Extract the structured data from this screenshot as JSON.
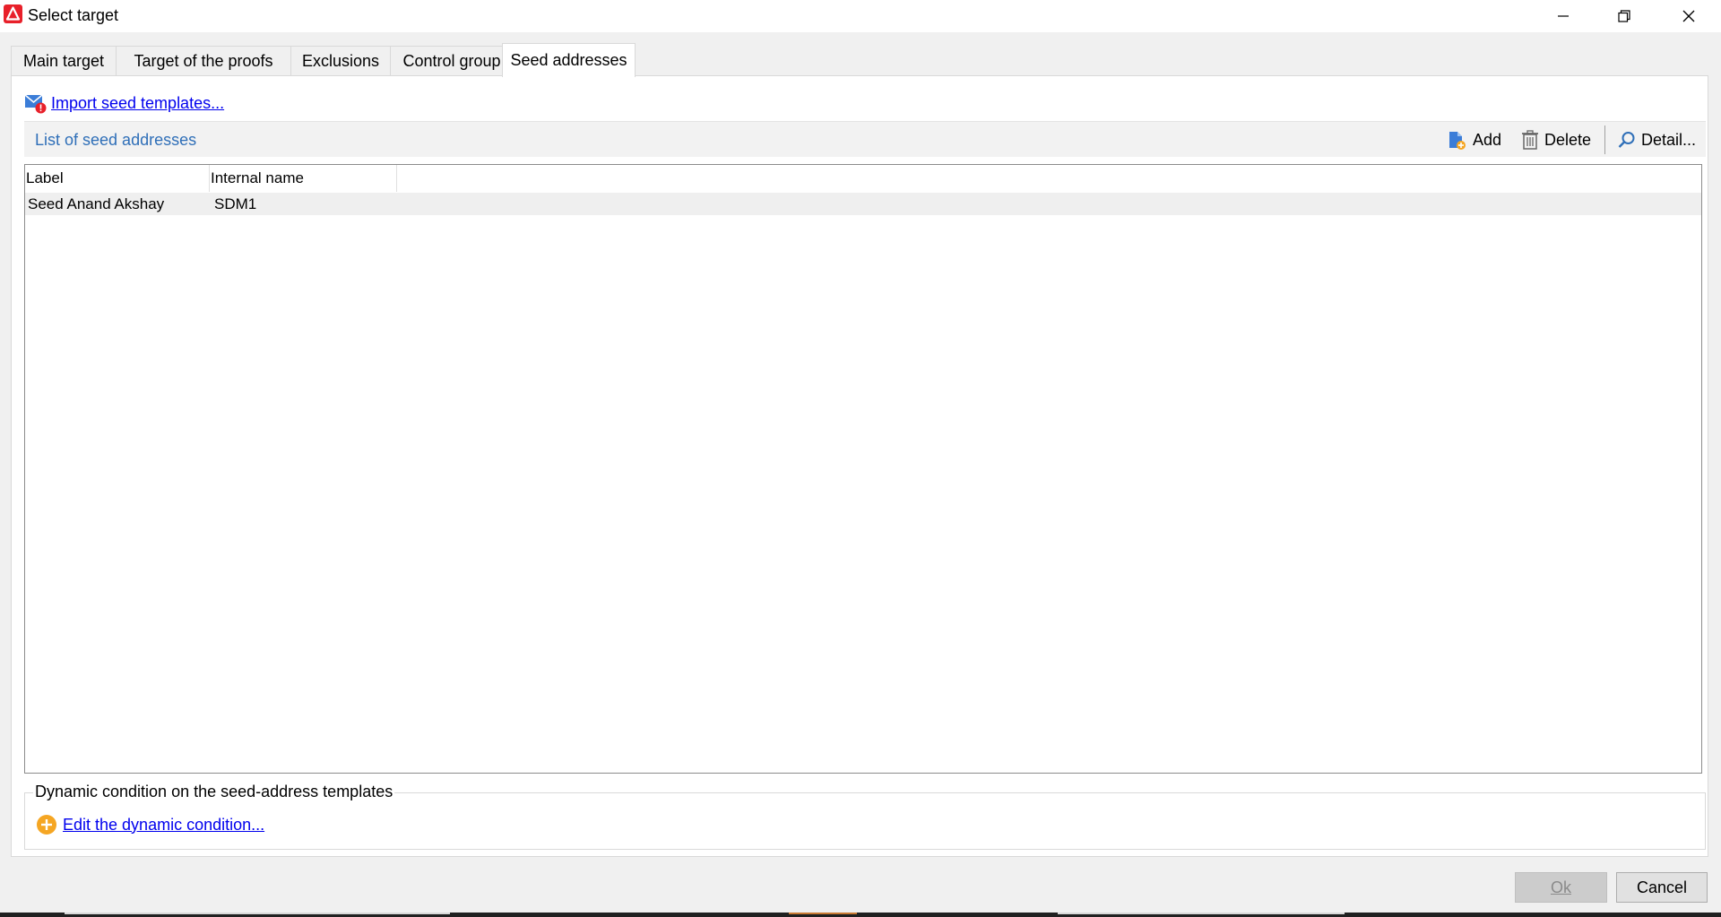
{
  "window": {
    "title": "Select target",
    "logo_icon": "adobe-campaign-logo",
    "controls": {
      "minimize_icon": "minimize-icon",
      "restore_icon": "restore-icon",
      "close_icon": "close-icon"
    }
  },
  "tabs": [
    {
      "label": "Main target",
      "active": false
    },
    {
      "label": "Target of the proofs",
      "active": false
    },
    {
      "label": "Exclusions",
      "active": false
    },
    {
      "label": "Control group",
      "active": false
    },
    {
      "label": "Seed addresses",
      "active": true
    }
  ],
  "import": {
    "label": "Import seed templates...",
    "icon": "mail-import-icon"
  },
  "list": {
    "title": "List of seed addresses",
    "toolbar": {
      "add_label": "Add",
      "delete_label": "Delete",
      "detail_label": "Detail..."
    },
    "columns": [
      "Label",
      "Internal name"
    ],
    "rows": [
      {
        "label": "Seed Anand Akshay",
        "internal_name": "SDM1"
      }
    ]
  },
  "dynamic": {
    "legend": "Dynamic condition on the seed-address templates",
    "edit_label": "Edit the dynamic condition..."
  },
  "buttons": {
    "ok_label": "Ok",
    "cancel_label": "Cancel"
  },
  "colors": {
    "accent_link": "#0000ee",
    "list_title": "#2f6fb8",
    "logo_red": "#e8202a",
    "plus_orange": "#f5a623"
  }
}
